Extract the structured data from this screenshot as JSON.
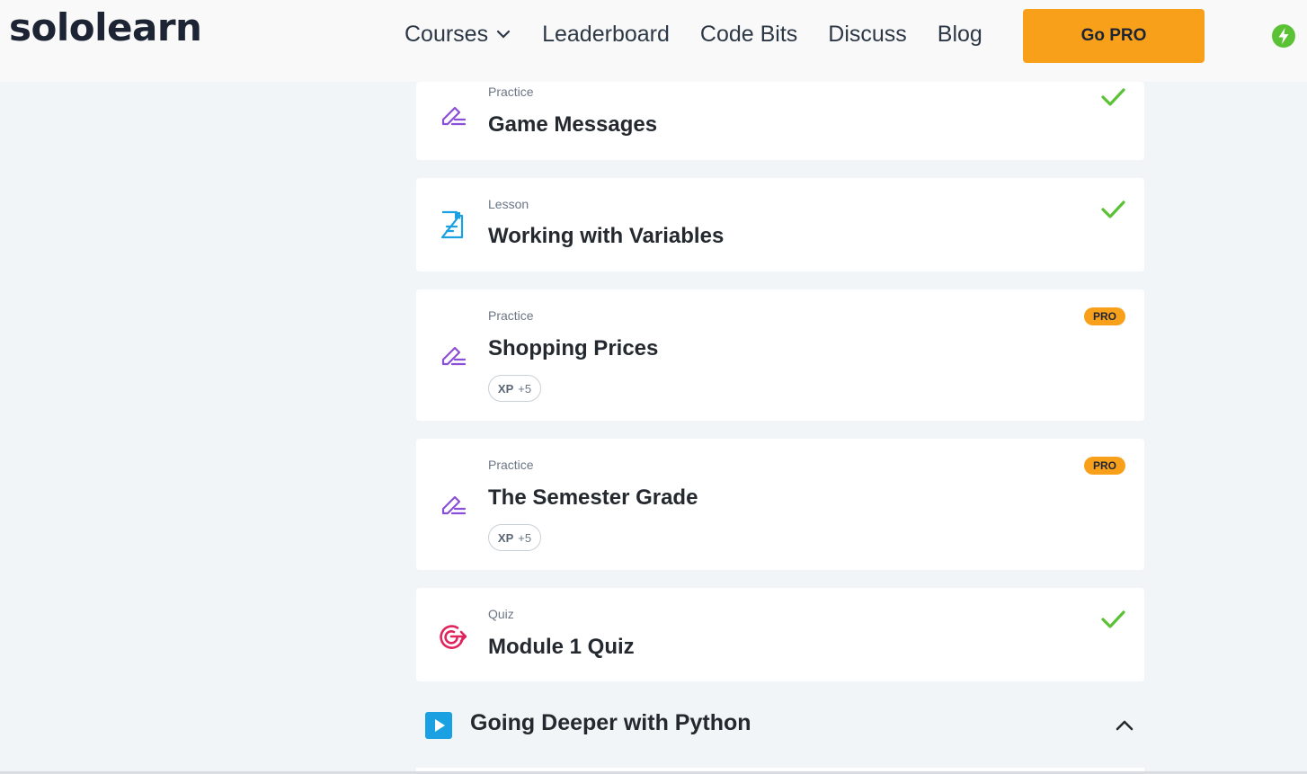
{
  "header": {
    "logo": "sololearn",
    "nav": [
      {
        "label": "Courses",
        "has_dropdown": true
      },
      {
        "label": "Leaderboard"
      },
      {
        "label": "Code Bits"
      },
      {
        "label": "Discuss"
      },
      {
        "label": "Blog"
      }
    ],
    "go_pro_label": "Go PRO",
    "energy_icon": "lightning-bolt-icon",
    "energy_color": "#5bc236"
  },
  "items": [
    {
      "type": "Practice",
      "title": "Game Messages",
      "icon": "pencil-edit-icon",
      "status": "completed"
    },
    {
      "type": "Lesson",
      "title": "Working with Variables",
      "icon": "document-icon",
      "status": "completed"
    },
    {
      "type": "Practice",
      "title": "Shopping Prices",
      "icon": "pencil-edit-icon",
      "status": "pro",
      "badge": "PRO",
      "xp_label": "XP",
      "xp_value": "+5"
    },
    {
      "type": "Practice",
      "title": "The Semester Grade",
      "icon": "pencil-edit-icon",
      "status": "pro",
      "badge": "PRO",
      "xp_label": "XP",
      "xp_value": "+5"
    },
    {
      "type": "Quiz",
      "title": "Module 1 Quiz",
      "icon": "target-icon",
      "status": "completed"
    }
  ],
  "module": {
    "title": "Going Deeper with Python",
    "icon": "play-icon",
    "toggle_icon": "chevron-up-icon"
  },
  "colors": {
    "accent_orange": "#f9a01b",
    "check_green": "#5bc236",
    "practice_purple": "#8a4fd8",
    "lesson_blue": "#1ba1e2",
    "quiz_pink": "#e0245e"
  }
}
